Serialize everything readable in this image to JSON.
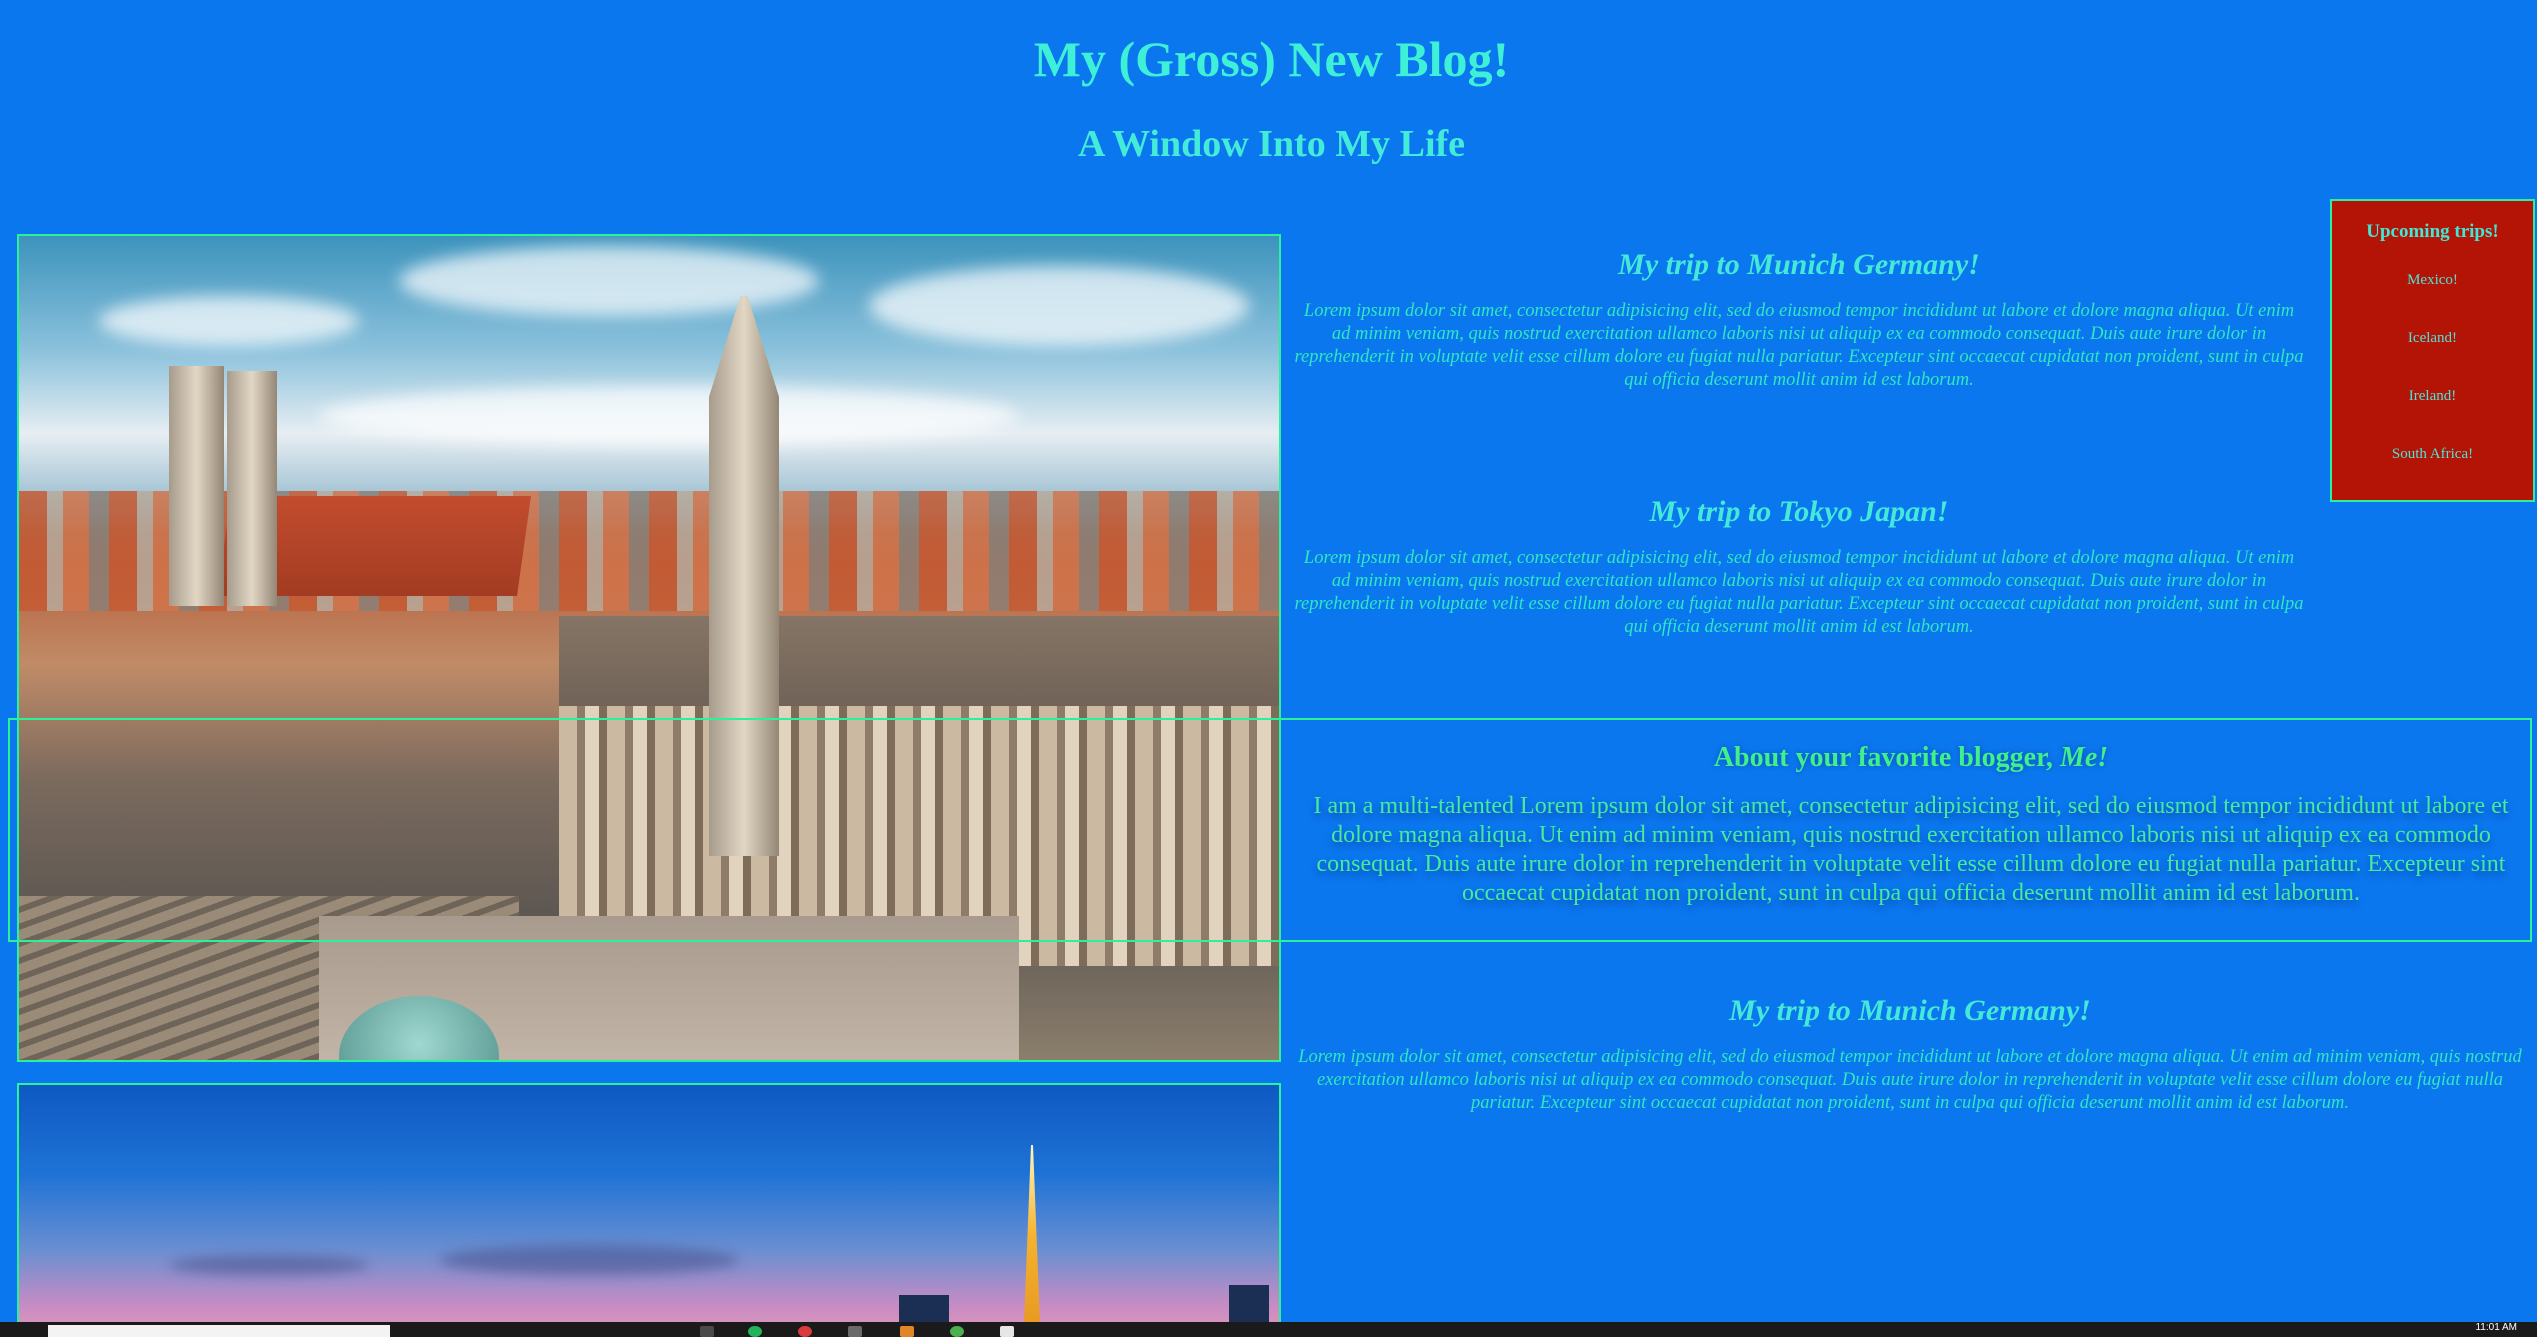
{
  "header": {
    "title": "My (Gross) New Blog!",
    "subtitle": "A Window Into My Life"
  },
  "posts": [
    {
      "title": "My trip to Munich Germany!",
      "body": "Lorem ipsum dolor sit amet, consectetur adipisicing elit, sed do eiusmod tempor incididunt ut labore et dolore magna aliqua. Ut enim ad minim veniam, quis nostrud exercitation ullamco laboris nisi ut aliquip ex ea commodo consequat. Duis aute irure dolor in reprehenderit in voluptate velit esse cillum dolore eu fugiat nulla pariatur. Excepteur sint occaecat cupidatat non proident, sunt in culpa qui officia deserunt mollit anim id est laborum."
    },
    {
      "title": "My trip to Tokyo Japan!",
      "body": "Lorem ipsum dolor sit amet, consectetur adipisicing elit, sed do eiusmod tempor incididunt ut labore et dolore magna aliqua. Ut enim ad minim veniam, quis nostrud exercitation ullamco laboris nisi ut aliquip ex ea commodo consequat. Duis aute irure dolor in reprehenderit in voluptate velit esse cillum dolore eu fugiat nulla pariatur. Excepteur sint occaecat cupidatat non proident, sunt in culpa qui officia deserunt mollit anim id est laborum."
    },
    {
      "title": "My trip to Munich Germany!",
      "body": "Lorem ipsum dolor sit amet, consectetur adipisicing elit, sed do eiusmod tempor incididunt ut labore et dolore magna aliqua. Ut enim ad minim veniam, quis nostrud exercitation ullamco laboris nisi ut aliquip ex ea commodo consequat. Duis aute irure dolor in reprehenderit in voluptate velit esse cillum dolore eu fugiat nulla pariatur. Excepteur sint occaecat cupidatat non proident, sunt in culpa qui officia deserunt mollit anim id est laborum."
    }
  ],
  "about": {
    "heading": "About your favorite blogger, ",
    "heading_emphasis": "Me!",
    "body": "I am a multi-talented Lorem ipsum dolor sit amet, consectetur adipisicing elit, sed do eiusmod tempor incididunt ut labore et dolore magna aliqua. Ut enim ad minim veniam, quis nostrud exercitation ullamco laboris nisi ut aliquip ex ea commodo consequat. Duis aute irure dolor in reprehenderit in voluptate velit esse cillum dolore eu fugiat nulla pariatur. Excepteur sint occaecat cupidatat non proident, sunt in culpa qui officia deserunt mollit anim id est laborum."
  },
  "sidebar": {
    "heading": "Upcoming trips!",
    "items": [
      "Mexico!",
      "Iceland!",
      "Ireland!",
      "South Africa!"
    ]
  },
  "taskbar": {
    "clock": "11:01 AM"
  },
  "colors": {
    "background": "#0b77ef",
    "heading_text": "#3ef0d6",
    "border": "#2af29a",
    "sidebar_background": "#b41406"
  },
  "icons": [
    "munich-photo",
    "tokyo-photo",
    "search-box",
    "taskbar-app-icon"
  ]
}
